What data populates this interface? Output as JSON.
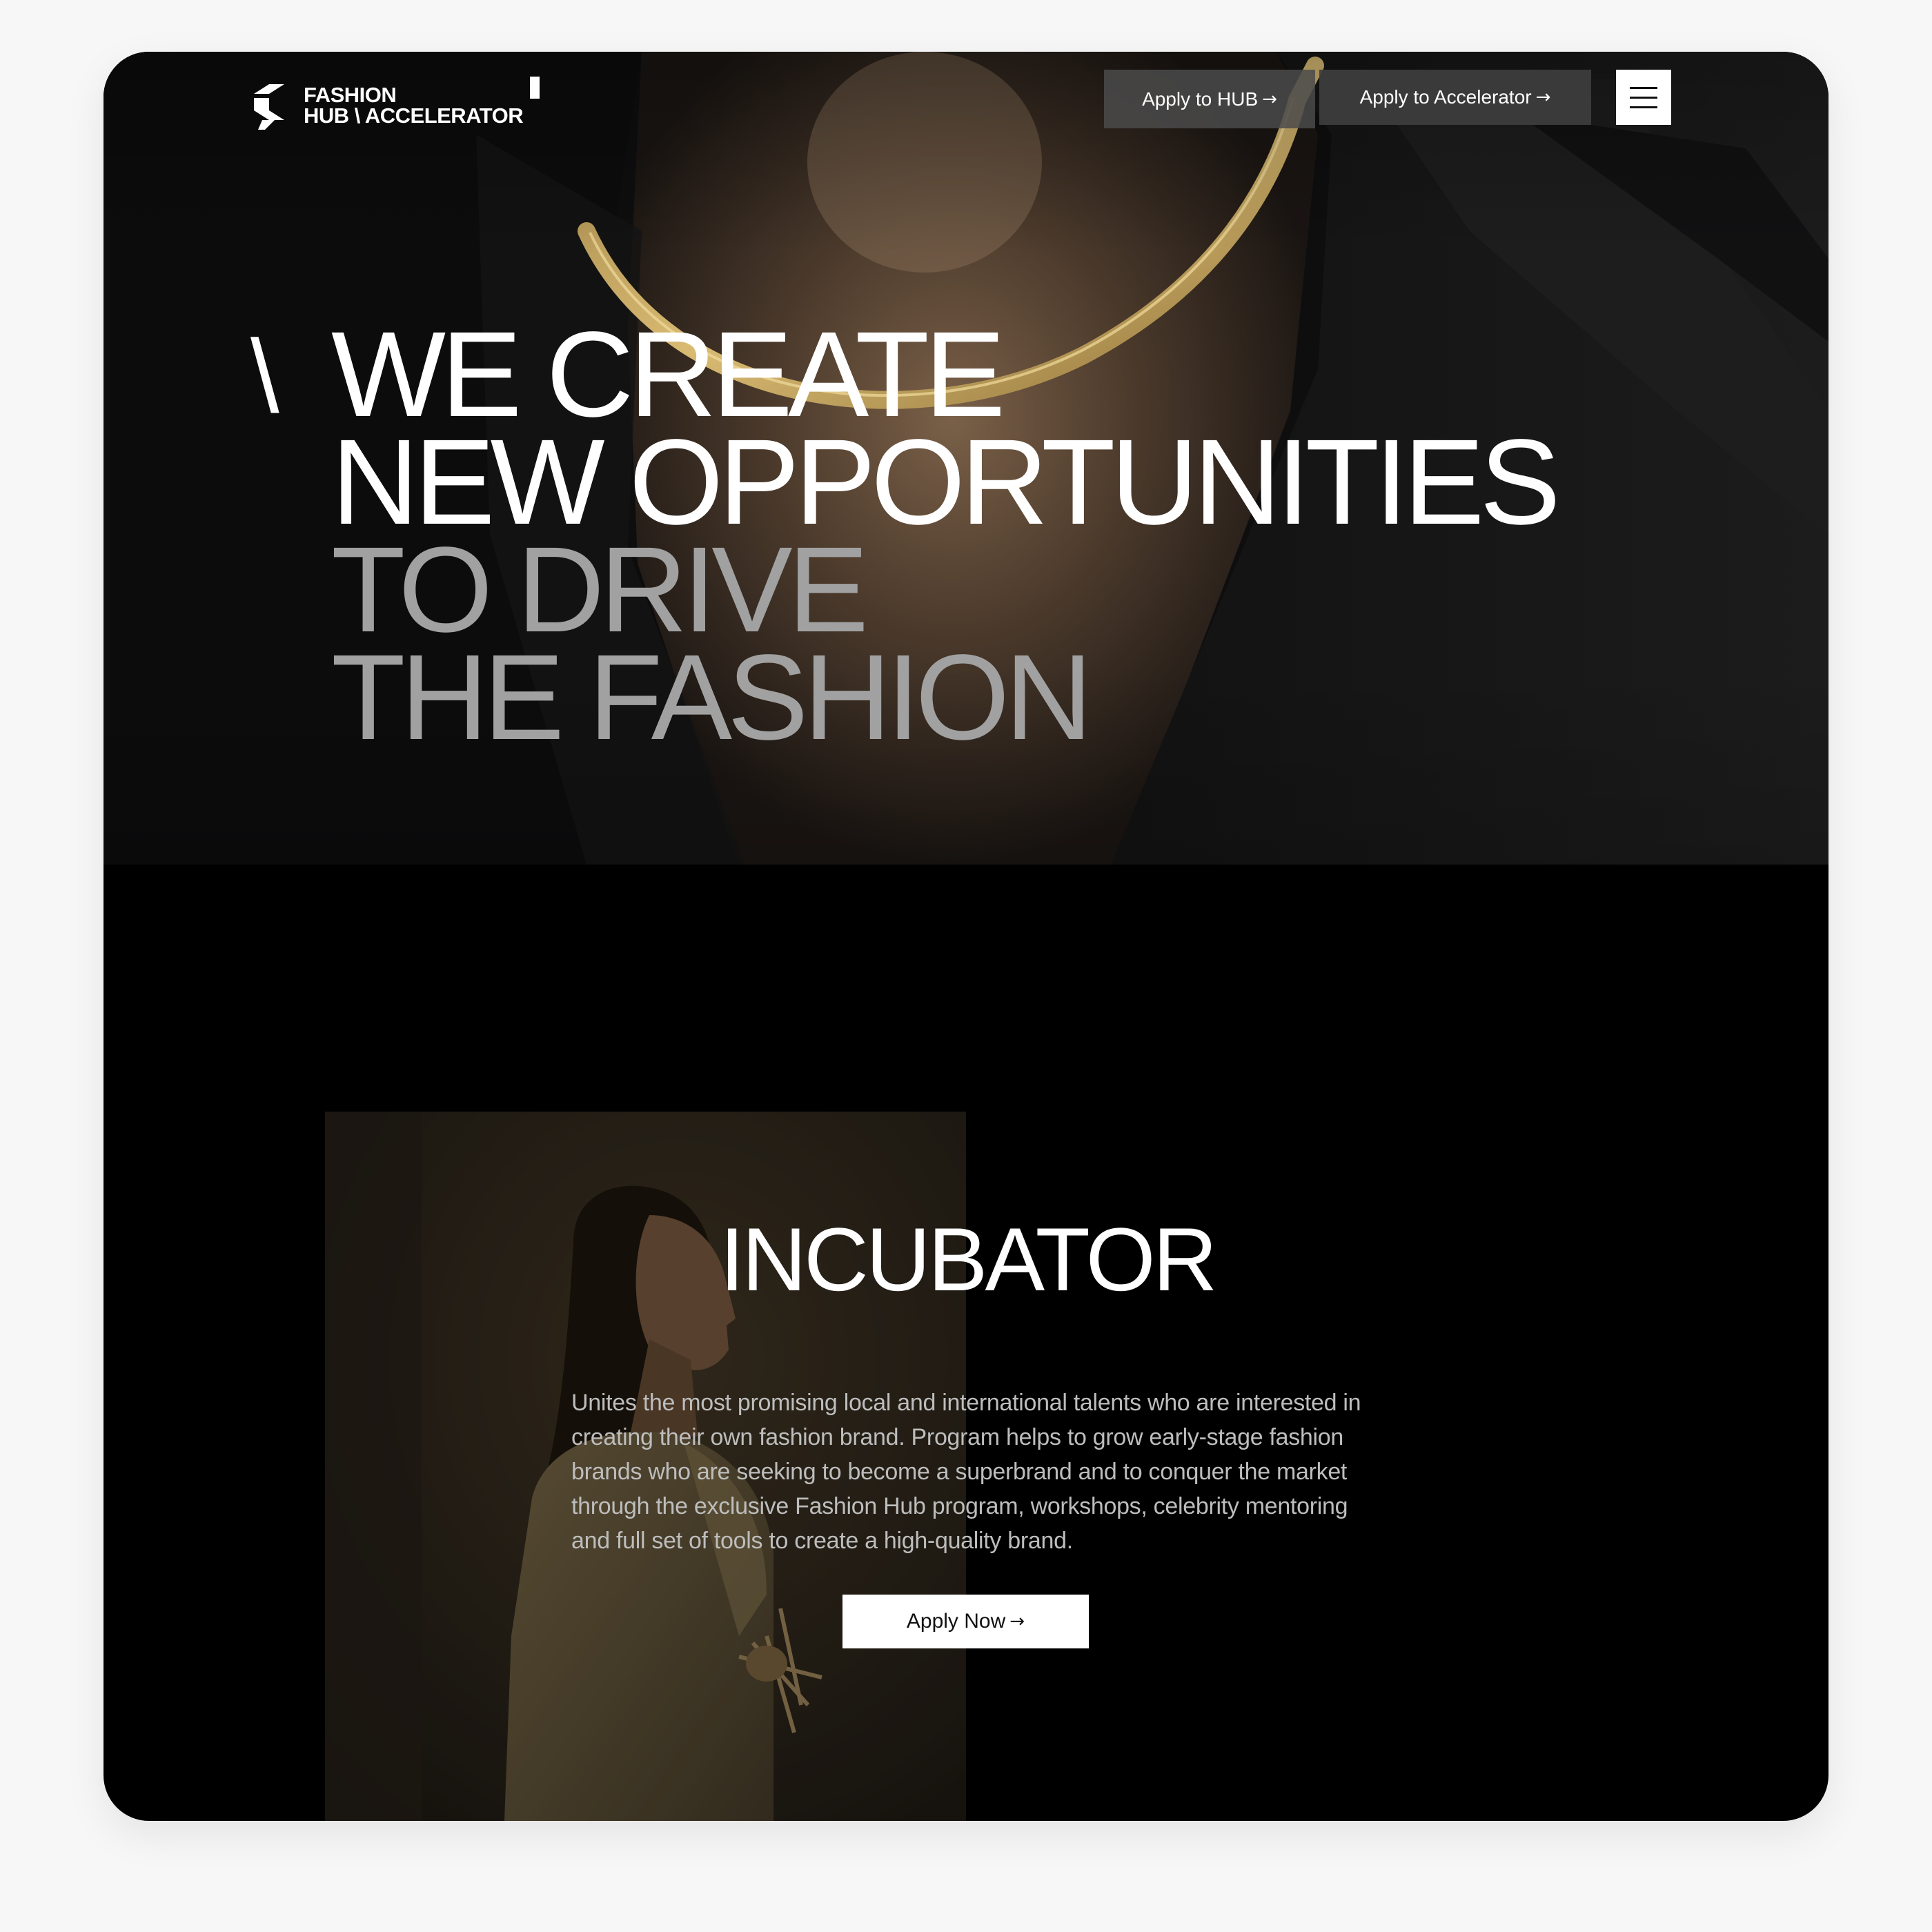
{
  "colors": {
    "background": "#f7f7f7",
    "frame": "#000000",
    "headline_white": "#ffffff",
    "headline_gray": "#a1a1a1",
    "body_text": "#bdbdbd",
    "button_dark": "#4b4b4b",
    "button_light": "#ffffff",
    "gold": "#c9a85a"
  },
  "header": {
    "logo": {
      "line1": "FASHION",
      "line2": "HUB \\ ACCELERATOR"
    },
    "apply_hub_label": "Apply to HUB",
    "apply_accelerator_label": "Apply to Accelerator",
    "arrow": "→",
    "menu_icon": "hamburger-menu-icon"
  },
  "hero": {
    "slash": "\\",
    "headline_lines": [
      "WE CREATE",
      "NEW OPPORTUNITIES",
      "TO DRIVE",
      "THE FASHION"
    ]
  },
  "incubator": {
    "title": "INCUBATOR",
    "description": "Unites the most promising local and international talents who are interested in creating their own fashion brand. Program helps to grow early-stage fashion brands who are seeking to become a superbrand and to conquer the market through the exclusive Fashion Hub program, workshops, celebrity mentoring and full set of tools to create a high-quality brand.",
    "apply_label": "Apply Now",
    "arrow": "→"
  }
}
